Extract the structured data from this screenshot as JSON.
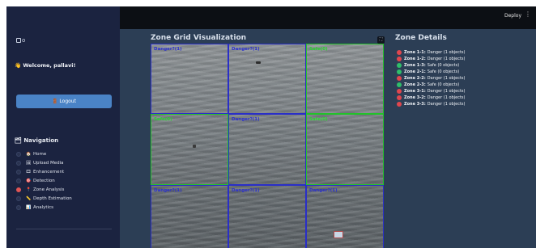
{
  "topbar": {
    "deploy_label": "Deploy",
    "menu_glyph": "⋮"
  },
  "sidebar": {
    "logo_text": "o",
    "welcome": "👋 Welcome, pallavi!",
    "logout_label": "🚪 Logout",
    "nav_title": "🗂 Navigation",
    "nav_items": [
      {
        "icon": "🏠",
        "label": "Home",
        "selected": false
      },
      {
        "icon": "🖼",
        "label": "Upload Media",
        "selected": false
      },
      {
        "icon": "🎞",
        "label": "Enhancement",
        "selected": false
      },
      {
        "icon": "🎯",
        "label": "Detection",
        "selected": false
      },
      {
        "icon": "📍",
        "label": "Zone Analysis",
        "selected": true
      },
      {
        "icon": "📏",
        "label": "Depth Estimation",
        "selected": false
      },
      {
        "icon": "📊",
        "label": "Analytics",
        "selected": false
      }
    ]
  },
  "main": {
    "viz_title": "Zone Grid Visualization",
    "expand_glyph": "⛶",
    "grid": [
      {
        "label": "Danger?(1)",
        "status": "danger"
      },
      {
        "label": "Danger?(1)",
        "status": "danger"
      },
      {
        "label": "Safe(0)",
        "status": "safe"
      },
      {
        "label": "Safe(0)",
        "status": "safe"
      },
      {
        "label": "Danger?(1)",
        "status": "danger"
      },
      {
        "label": "Safe(0)",
        "status": "safe"
      },
      {
        "label": "Danger?(1)",
        "status": "danger"
      },
      {
        "label": "Danger?(1)",
        "status": "danger"
      },
      {
        "label": "Danger?(1)",
        "status": "danger"
      }
    ],
    "details_title": "Zone Details",
    "zones": [
      {
        "name": "Zone 1-1:",
        "status": "Danger (1 objects)",
        "color": "#e0464e"
      },
      {
        "name": "Zone 1-2:",
        "status": "Danger (1 objects)",
        "color": "#e0464e"
      },
      {
        "name": "Zone 1-3:",
        "status": "Safe (0 objects)",
        "color": "#2fbf6a"
      },
      {
        "name": "Zone 2-1:",
        "status": "Safe (0 objects)",
        "color": "#2fbf6a"
      },
      {
        "name": "Zone 2-2:",
        "status": "Danger (1 objects)",
        "color": "#e0464e"
      },
      {
        "name": "Zone 2-3:",
        "status": "Safe (0 objects)",
        "color": "#2fbf6a"
      },
      {
        "name": "Zone 3-1:",
        "status": "Danger (1 objects)",
        "color": "#e0464e"
      },
      {
        "name": "Zone 3-2:",
        "status": "Danger (1 objects)",
        "color": "#e0464e"
      },
      {
        "name": "Zone 3-3:",
        "status": "Danger (1 objects)",
        "color": "#e0464e"
      }
    ]
  }
}
